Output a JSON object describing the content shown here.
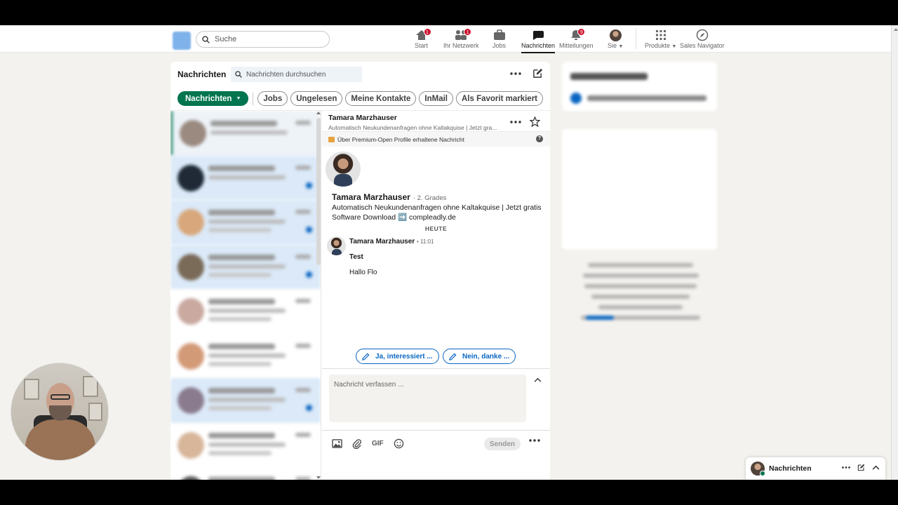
{
  "topnav": {
    "search_placeholder": "Suche",
    "items": [
      {
        "label": "Start",
        "badge": "1"
      },
      {
        "label": "Ihr Netzwerk",
        "badge": "1"
      },
      {
        "label": "Jobs"
      },
      {
        "label": "Nachrichten"
      },
      {
        "label": "Mitteilungen",
        "badge": "9"
      },
      {
        "label": "Sie"
      },
      {
        "label": "Produkte"
      },
      {
        "label": "Sales Navigator"
      }
    ]
  },
  "messaging": {
    "title": "Nachrichten",
    "search_placeholder": "Nachrichten durchsuchen",
    "filters": [
      "Nachrichten",
      "Jobs",
      "Ungelesen",
      "Meine Kontakte",
      "InMail",
      "Als Favorit markiert"
    ]
  },
  "thread": {
    "name": "Tamara Marzhauser",
    "subtitle": "Automatisch Neukundenanfragen ohne Kaltakquise | Jetzt gra...",
    "premium_note": "Über Premium-Open Profile erhaltene Nachricht",
    "profile_name": "Tamara Marzhauser",
    "degree": "· 2. Grades",
    "headline": "Automatisch Neukundenanfragen ohne Kaltakquise | Jetzt gratis Software Download ➡️ compleadly.de",
    "day_divider": "HEUTE",
    "message": {
      "sender": "Tamara Marzhauser",
      "time": "• 11:01",
      "subject": "Test",
      "body": "Hallo Flo"
    },
    "smart_replies": [
      "Ja, interessiert ...",
      "Nein, danke ..."
    ],
    "composer_placeholder": "Nachricht verfassen ...",
    "gif_label": "GIF",
    "send_label": "Senden"
  },
  "overlay": {
    "label": "Nachrichten"
  },
  "colors": {
    "accent_green": "#01754f",
    "link_blue": "#0a66c2",
    "badge_red": "#cb112d"
  }
}
